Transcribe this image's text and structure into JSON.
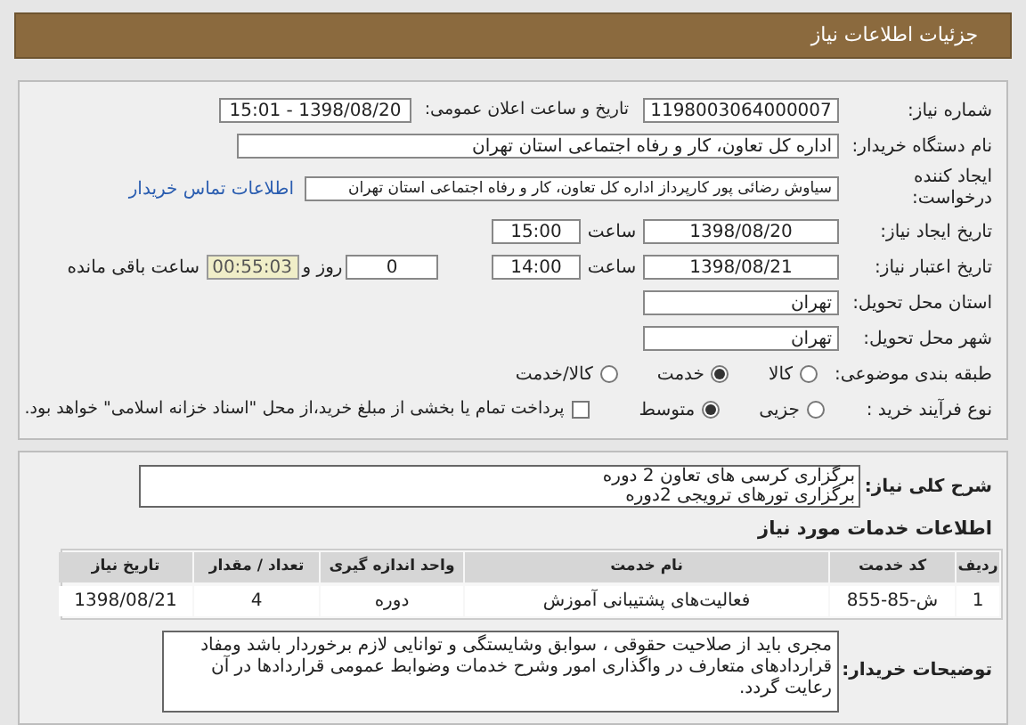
{
  "header": {
    "title": "جزئیات اطلاعات نیاز"
  },
  "need_number": {
    "label": "شماره نیاز:",
    "value": "1198003064000007"
  },
  "announce": {
    "label": "تاریخ و ساعت اعلان عمومی:",
    "value": "1398/08/20 - 15:01"
  },
  "buyer_org": {
    "label": "نام دستگاه خریدار:",
    "value": "اداره کل تعاون، کار و رفاه اجتماعی استان تهران"
  },
  "creator": {
    "label": "ایجاد کننده درخواست:",
    "value": "سیاوش  رضائی پور کارپرداز اداره کل تعاون، کار و رفاه اجتماعی استان تهران",
    "link": "اطلاعات تماس خریدار"
  },
  "created": {
    "label": "تاریخ ایجاد نیاز:",
    "date": "1398/08/20",
    "time_label": "ساعت",
    "time": "15:00"
  },
  "validity": {
    "label": "تاریخ اعتبار نیاز:",
    "date": "1398/08/21",
    "time_label": "ساعت",
    "time": "14:00",
    "days": "0",
    "days_label": "روز و",
    "remaining": "00:55:03",
    "remaining_label": "ساعت باقی مانده"
  },
  "province": {
    "label": "استان محل تحویل:",
    "value": "تهران"
  },
  "city": {
    "label": "شهر محل تحویل:",
    "value": "تهران"
  },
  "category": {
    "label": "طبقه بندی موضوعی:",
    "options": [
      {
        "label": "کالا",
        "selected": false
      },
      {
        "label": "خدمت",
        "selected": true
      },
      {
        "label": "کالا/خدمت",
        "selected": false
      }
    ]
  },
  "process": {
    "label": "نوع فرآیند خرید :",
    "options": [
      {
        "label": "جزیی",
        "selected": false
      },
      {
        "label": "متوسط",
        "selected": true
      }
    ],
    "payment": {
      "checked": false,
      "label": "پرداخت تمام یا بخشی از مبلغ خرید،از محل \"اسناد خزانه اسلامی\" خواهد بود."
    }
  },
  "description": {
    "label": "شرح کلی نیاز:",
    "lines": [
      "برگزاری کرسی های تعاون 2 دوره",
      "برگزاری تورهای ترویجی 2دوره"
    ]
  },
  "services": {
    "title": "اطلاعات خدمات مورد نیاز",
    "columns": [
      "ردیف",
      "کد خدمت",
      "نام خدمت",
      "واحد اندازه گیری",
      "تعداد / مقدار",
      "تاریخ نیاز"
    ],
    "rows": [
      [
        "1",
        "ش-85-855",
        "فعالیت‌های پشتیبانی آموزش",
        "دوره",
        "4",
        "1398/08/21"
      ]
    ]
  },
  "buyer_notes": {
    "label": "توضیحات خریدار:",
    "text": "مجری باید از صلاحیت حقوقی ، سوابق وشایستگی و توانایی لازم برخوردار باشد ومفاد قراردادهای متعارف در واگذاری امور وشرح خدمات وضوابط عمومی قراردادها در آن رعایت گردد."
  }
}
